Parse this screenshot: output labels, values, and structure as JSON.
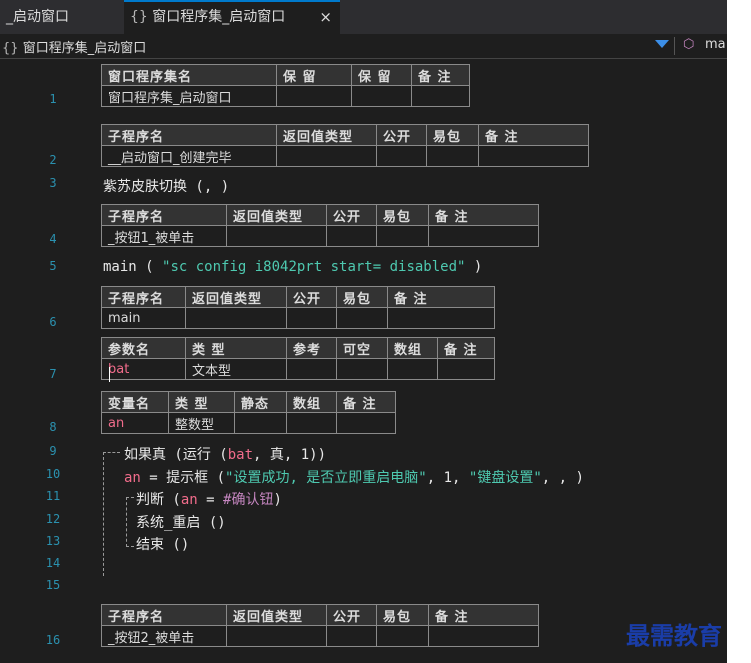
{
  "tabs": [
    {
      "label": "_启动窗口"
    },
    {
      "brace": "{}",
      "label": "窗口程序集_启动窗口",
      "close": "×"
    }
  ],
  "navbar": {
    "brace": "{}",
    "left": "窗口程序集_启动窗口",
    "right": "ma",
    "dropdown_icon": "chevron-down-icon",
    "cube_icon": "cube-icon"
  },
  "line_numbers": [
    "1",
    "2",
    "3",
    "4",
    "5",
    "6",
    "7",
    "8",
    "9",
    "10",
    "11",
    "12",
    "13",
    "14",
    "15",
    "16"
  ],
  "assembly_table": {
    "headers": [
      "窗口程序集名",
      "保 留",
      "保 留",
      "备 注"
    ],
    "row": [
      "窗口程序集_启动窗口",
      "",
      "",
      ""
    ]
  },
  "sub1_table": {
    "headers": [
      "子程序名",
      "返回值类型",
      "公开",
      "易包",
      "备 注"
    ],
    "row": [
      "__启动窗口_创建完毕",
      "",
      "",
      "",
      ""
    ]
  },
  "line3": "紫苏皮肤切换 (, )",
  "sub2_table": {
    "headers": [
      "子程序名",
      "返回值类型",
      "公开",
      "易包",
      "备 注"
    ],
    "row": [
      "_按钮1_被单击",
      "",
      "",
      "",
      ""
    ]
  },
  "line5": {
    "prefix": "main ( ",
    "string": "\"sc config i8042prt start= disabled\"",
    "suffix": " )"
  },
  "main_table": {
    "headers": [
      "子程序名",
      "返回值类型",
      "公开",
      "易包",
      "备 注"
    ],
    "row": [
      "main",
      "",
      "",
      "",
      ""
    ],
    "param_headers": [
      "参数名",
      "类 型",
      "参考",
      "可空",
      "数组",
      "备 注"
    ],
    "param_row": [
      "bat",
      "文本型",
      "",
      "",
      "",
      ""
    ]
  },
  "var_table": {
    "headers": [
      "变量名",
      "类 型",
      "静态",
      "数组",
      "备 注"
    ],
    "row": [
      "an",
      "整数型",
      "",
      "",
      ""
    ]
  },
  "line9": {
    "a": "如果真 (运行 (",
    "var": "bat",
    "b": ", 真, 1))"
  },
  "line10": {
    "var": "an",
    "a": " = 提示框 (",
    "s1": "\"设置成功, 是否立即重启电脑\"",
    "b": ", 1, ",
    "s2": "\"键盘设置\"",
    "c": ", , )"
  },
  "line11": {
    "a": "判断 (",
    "var": "an",
    "b": " = ",
    "const": "#确认钮",
    "c": ")"
  },
  "line12": "系统_重启 ()",
  "line13": "结束 ()",
  "sub3_table": {
    "headers": [
      "子程序名",
      "返回值类型",
      "公开",
      "易包",
      "备 注"
    ],
    "row": [
      "_按钮2_被单击",
      "",
      "",
      "",
      ""
    ]
  },
  "watermark": "最需教育"
}
